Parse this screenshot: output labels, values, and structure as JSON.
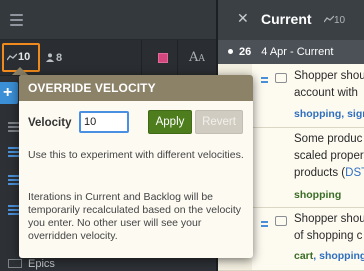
{
  "toolbar": {
    "velocity_value": "10",
    "points_value": "8",
    "font_label_big": "A",
    "font_label_small": "A"
  },
  "sidebar": {
    "add_label": "+",
    "epics_label": "Epics"
  },
  "panel": {
    "close_label": "✕",
    "title": "Current",
    "velocity": "10",
    "iteration_number": "26",
    "iteration_label": "4 Apr - Current"
  },
  "stories": [
    {
      "line1": "Shopper shou",
      "line2": "account with",
      "labels": "shopping, signu"
    },
    {
      "line1": "Some produc",
      "line2": "scaled proper",
      "line3_prefix": "products (",
      "line3_link": "DST",
      "labels": "shopping"
    },
    {
      "line1": "Shopper shou",
      "line2": "of shopping c",
      "labels_1": "cart",
      "labels_2": ", shopping"
    }
  ],
  "popover": {
    "title": "OVERRIDE VELOCITY",
    "velocity_label": "Velocity",
    "velocity_input_value": "10",
    "apply_label": "Apply",
    "revert_label": "Revert",
    "help_text_1": "Use this to experiment with different velocities.",
    "help_text_2": "Iterations in Current and Backlog will be temporarily recalculated based on the velocity you enter. No other user will see your overridden velocity."
  },
  "colors": {
    "velocity_highlight": "#f08a1c",
    "popover_header": "#8c8268",
    "apply_button": "#4d7d1c",
    "label_green": "#3a6d26",
    "label_blue": "#2f6fbf",
    "stop_button": "#d4477e"
  },
  "icons": {
    "velocity": "trend-line-icon",
    "points": "person-icon",
    "menu": "hamburger-icon",
    "story_type": "feature-icon",
    "comment": "comment-icon"
  }
}
